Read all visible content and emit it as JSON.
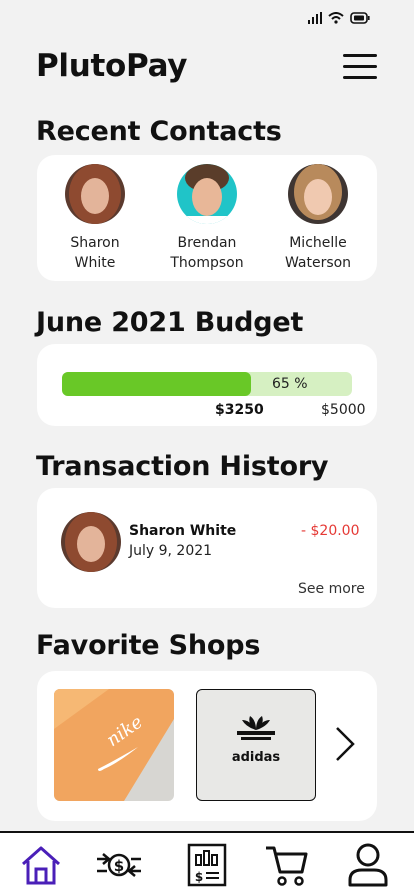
{
  "app": {
    "title": "PlutoPay"
  },
  "contacts": {
    "title": "Recent Contacts",
    "items": [
      {
        "first": "Sharon",
        "last": "White"
      },
      {
        "first": "Brendan",
        "last": "Thompson"
      },
      {
        "first": "Michelle",
        "last": "Waterson"
      }
    ]
  },
  "budget": {
    "title": "June 2021 Budget",
    "percent_label": "65 %",
    "progress_fraction": 0.65,
    "spent": "$3250",
    "limit": "$5000"
  },
  "transactions": {
    "title": "Transaction History",
    "items": [
      {
        "name": "Sharon White",
        "date": "July 9, 2021",
        "amount": "- $20.00"
      }
    ],
    "see_more": "See more"
  },
  "shops": {
    "title": "Favorite Shops",
    "nike_logo_text": "nike",
    "adidas_logo_text": "adidas"
  },
  "nav": {
    "items": [
      "home-icon",
      "transfer-money-icon",
      "statement-icon",
      "cart-icon",
      "profile-icon"
    ],
    "active": "home-icon",
    "active_color": "#4a1fb8"
  },
  "colors": {
    "progress_fill": "#69c827",
    "progress_track": "#d6f0c2",
    "negative_amount": "#e53935"
  }
}
